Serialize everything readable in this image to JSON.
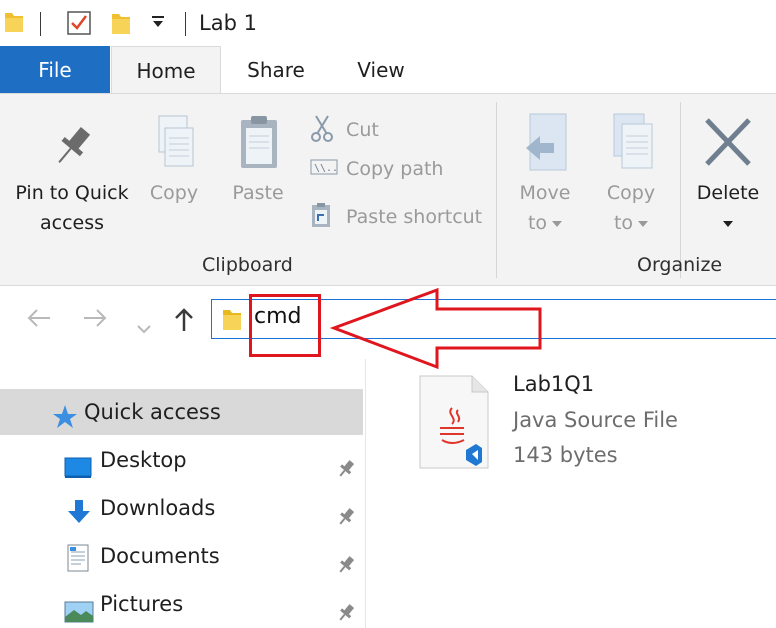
{
  "window": {
    "title": "Lab 1",
    "qat_dropdown_icon": "dropdown-caret-icon"
  },
  "tabs": [
    {
      "label": "File"
    },
    {
      "label": "Home"
    },
    {
      "label": "Share"
    },
    {
      "label": "View"
    }
  ],
  "ribbon": {
    "clipboard": {
      "pin_label_1": "Pin to Quick",
      "pin_label_2": "access",
      "copy_label": "Copy",
      "paste_label": "Paste",
      "cut_label": "Cut",
      "copy_path_label": "Copy path",
      "paste_shortcut_label": "Paste shortcut",
      "group_label": "Clipboard"
    },
    "organize": {
      "move_label_1": "Move",
      "move_label_2": "to",
      "copy_label_1": "Copy",
      "copy_label_2": "to",
      "delete_label": "Delete",
      "group_label": "Organize"
    }
  },
  "address_bar": {
    "value": "cmd"
  },
  "navigation_pane": {
    "items": [
      {
        "label": "Quick access",
        "icon": "star-icon",
        "selected": true
      },
      {
        "label": "Desktop",
        "icon": "desktop-icon",
        "pinned": true
      },
      {
        "label": "Downloads",
        "icon": "download-arrow-icon",
        "pinned": true
      },
      {
        "label": "Documents",
        "icon": "documents-icon",
        "pinned": true
      },
      {
        "label": "Pictures",
        "icon": "pictures-icon",
        "pinned": true
      }
    ]
  },
  "files": [
    {
      "name": "Lab1Q1",
      "type": "Java Source File",
      "size": "143 bytes",
      "icon": "java-file-icon"
    }
  ],
  "colors": {
    "file_tab": "#1e6fc4",
    "address_border": "#1a73d9",
    "annotation_red": "#e0161e",
    "ribbon_bg": "#f3f3f3",
    "selected_bg": "#d9d9d9"
  }
}
